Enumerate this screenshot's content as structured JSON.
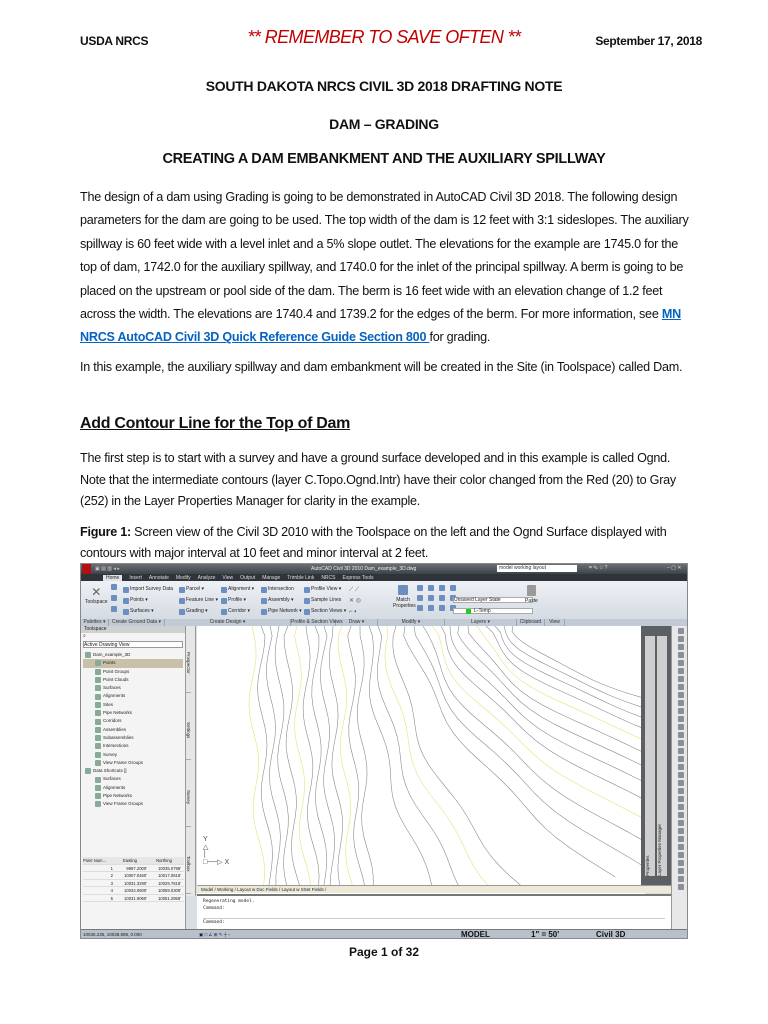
{
  "header": {
    "left": "USDA NRCS",
    "center": "** REMEMBER TO SAVE OFTEN **",
    "right": "September 17, 2018"
  },
  "titles": [
    "SOUTH DAKOTA NRCS CIVIL 3D 2018 DRAFTING NOTE",
    "DAM – GRADING",
    "CREATING A DAM EMBANKMENT AND THE AUXILIARY SPILLWAY"
  ],
  "intro": {
    "before": "The design of a dam using Grading is going to be demonstrated in AutoCAD Civil 3D 2018.  The following design parameters for the dam are going to be used.  The top width of the dam is 12 feet with 3:1 sideslopes.  The auxiliary spillway is 60 feet wide with a level inlet and a 5% slope outlet.  The elevations for the example are 1745.0 for the top of dam, 1742.0 for the auxiliary spillway, and 1740.0 for the inlet of the principal spillway.  A berm is going to be placed on the upstream or pool side of the dam.  The berm is 16 feet wide with an elevation change of 1.2 feet across the width.  The elevations are 1740.4 and 1739.2 for the edges of the berm.  For more information, see ",
    "link": "MN NRCS AutoCAD Civil 3D Quick Reference Guide Section 800 ",
    "after": "for grading."
  },
  "para2": "In this example, the auxiliary spillway and dam embankment will be created in the Site (in Toolspace) called Dam.",
  "section_heading": "Add Contour Line for the Top of Dam",
  "para3": "The first step is to start with a survey and have a ground surface developed and in this example is called Ognd.  Note that the intermediate contours (layer C.Topo.Ognd.Intr) have their color changed from the Red (20) to Gray (252) in the Layer Properties Manager for clarity in the example.",
  "caption": {
    "label": "Figure 1:",
    "text": "  Screen view of the Civil 3D 2010 with the Toolspace on the left and the Ognd Surface displayed with contours with major interval at 10 feet and minor interval at 2 feet."
  },
  "screenshot": {
    "title": "AutoCAD Civil 3D 2010    Dam_example_3D.dwg",
    "search": "model working layout",
    "tabs": [
      "Home",
      "Insert",
      "Annotate",
      "Modify",
      "Analyze",
      "View",
      "Output",
      "Manage",
      "Trimble Link",
      "NRCS",
      "Express Tools"
    ],
    "ribbon": {
      "toolspace": "Toolspace",
      "ground": [
        "Import Survey Data",
        "Points ▾",
        "Surfaces ▾"
      ],
      "design1": [
        "Parcel ▾",
        "Feature Line ▾",
        "Grading ▾"
      ],
      "design2": [
        "Alignment ▾",
        "Profile ▾",
        "Corridor ▾"
      ],
      "design3": [
        "Intersection",
        "Assembly ▾",
        "Pipe Network ▾"
      ],
      "views": [
        "Profile View ▾",
        "Sample Lines",
        "Section Views ▾"
      ],
      "match": "Match Properties",
      "layer_state": "Unsaved Layer State",
      "layer": "L-Temp",
      "paste": "Paste"
    },
    "panels": [
      "Palettes ▾",
      "Create Ground Data ▾",
      "Create Design ▾",
      "Profile & Section Views",
      "Draw ▾",
      "Modify ▾",
      "Layers ▾",
      "Clipboard",
      "View"
    ],
    "toolspace": {
      "title": "Toolspace",
      "view": "Active Drawing View",
      "tree": [
        "Dam_example_3D",
        "Points",
        "Point Groups",
        "Point Clouds",
        "Surfaces",
        "Alignments",
        "Sites",
        "Pipe Networks",
        "Corridors",
        "Assemblies",
        "Subassemblies",
        "Intersections",
        "Survey",
        "View Frame Groups",
        "Data Shortcuts []",
        "Surfaces",
        "Alignments",
        "Pipe Networks",
        "View Frame Groups"
      ],
      "vtabs": [
        "Prospector",
        "Settings",
        "Survey",
        "Toolbox"
      ],
      "table_headers": [
        "Point Num...",
        "Easting",
        "Northing"
      ],
      "rows": [
        [
          "1",
          "9997.2000'",
          "10035.0798'"
        ],
        [
          "2",
          "10007.0460'",
          "10017.0618'"
        ],
        [
          "3",
          "10031.3290'",
          "10029.7818'"
        ],
        [
          "4",
          "10034.0600'",
          "10059.0308'"
        ],
        [
          "5",
          "10031.9060'",
          "10051.2958'"
        ]
      ]
    },
    "palettes": [
      "Properties",
      "Layer Properties Manager"
    ],
    "layout_tabs": "Model / Working / Layout w Doc Fields / Layout w SSet Fields /",
    "command_lines": [
      "Regenerating model.",
      "Command:",
      "",
      "Command:"
    ],
    "coords": "10036.235, 10038.898, 0.000",
    "model": "MODEL",
    "scale": "1\" = 50'",
    "annotation": "Civil 3D"
  },
  "footer": "Page 1 of 32"
}
